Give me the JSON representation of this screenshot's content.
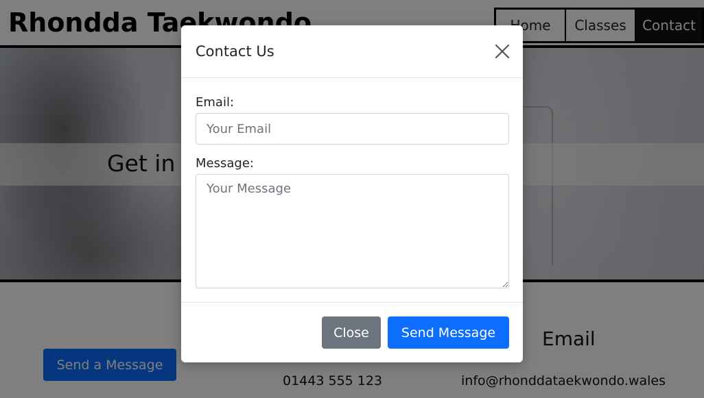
{
  "header": {
    "site_title": "Rhondda Taekwondo",
    "nav": [
      {
        "label": "Home"
      },
      {
        "label": "Classes"
      },
      {
        "label": "Contact"
      }
    ]
  },
  "hero": {
    "heading": "Get in Touch"
  },
  "contact": {
    "send_message_label": "Send a Message",
    "email_heading": "Email",
    "phone": "01443 555 123",
    "email": "info@rhonddataekwondo.wales"
  },
  "modal": {
    "title": "Contact Us",
    "email_label": "Email:",
    "email_placeholder": "Your Email",
    "message_label": "Message:",
    "message_placeholder": "Your Message",
    "close_label": "Close",
    "send_label": "Send Message"
  },
  "colors": {
    "primary": "#0d6efd",
    "secondary": "#6c757d",
    "backdrop": "rgba(0,0,0,0.5)"
  }
}
